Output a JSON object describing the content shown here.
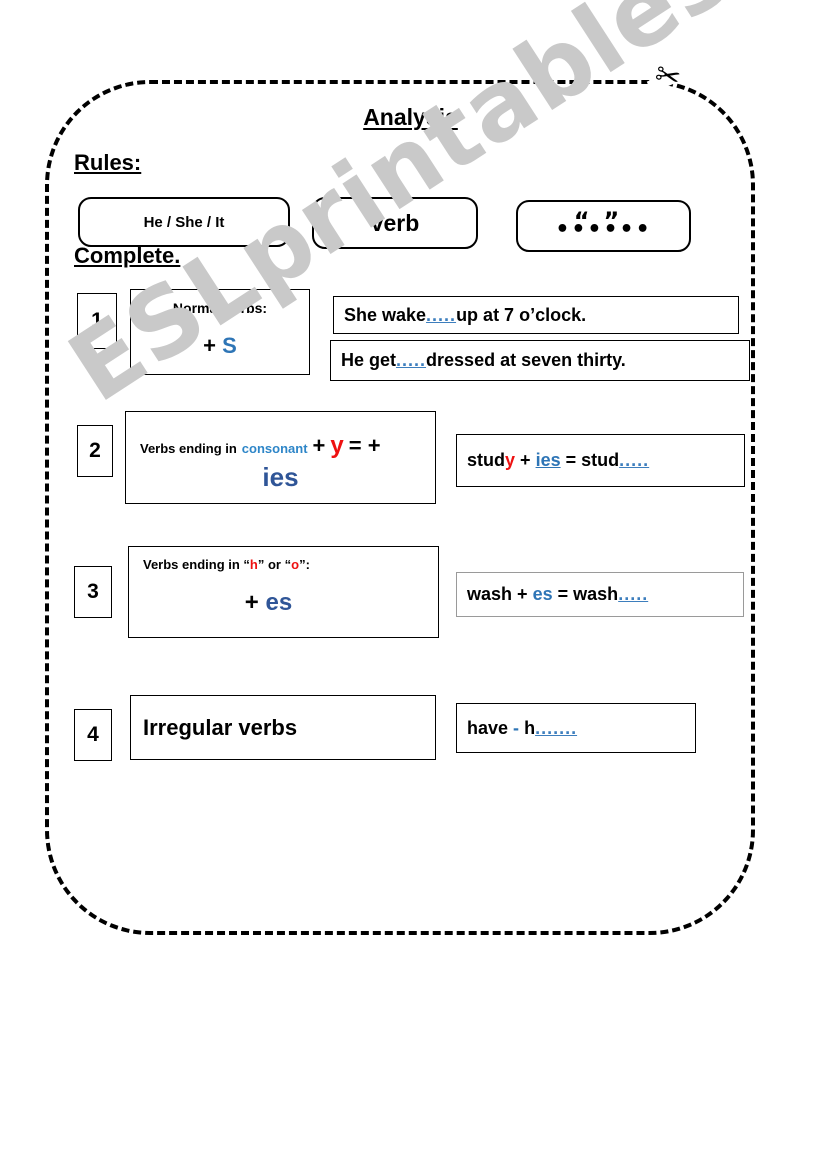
{
  "worksheet": {
    "title": "Analysis",
    "watermark": "ESLprintables.com",
    "cut_icon": "✂",
    "rules_heading": "Rules:",
    "complete_heading": "Complete.",
    "formula_chips": [
      {
        "name": "subject",
        "label": "He / She / It"
      },
      {
        "name": "verb",
        "label": "verb"
      },
      {
        "name": "ending",
        "quotes_open": "“",
        "quotes_close": "”",
        "dots": "••••••"
      }
    ],
    "rows": [
      {
        "number": "1",
        "rule": {
          "line1": "Normal verbs:",
          "big_plus": "+",
          "big_suffix": "S"
        },
        "exercises": [
          {
            "pre": "She wake",
            "blank": ".....",
            "post": " up at 7 o’clock."
          },
          {
            "pre": "He get",
            "blank": ".....",
            "post": " dressed at seven thirty."
          }
        ]
      },
      {
        "number": "2",
        "rule": {
          "line1_pre": "Verbs ending in",
          "line1_blue": "consonant",
          "line1_plus": "+",
          "line1_y": "y",
          "line1_eq": "= +",
          "line2": "ies"
        },
        "exercises": [
          {
            "word_pre": "stud",
            "word_red": "y",
            "plus": "+",
            "suffix": "ies",
            "eq": "=",
            "result": "stud",
            "blank": "....."
          }
        ]
      },
      {
        "number": "3",
        "rule": {
          "line1_pre": "Verbs ending in “",
          "line1_red1": "h",
          "line1_mid": "” or “",
          "line1_red2": "o",
          "line1_post": "”:",
          "plus": "+",
          "suffix": "es"
        },
        "exercises": [
          {
            "word": "wash",
            "plus": "+",
            "suffix": "es",
            "eq": "=",
            "result": "wash",
            "blank": "....."
          }
        ]
      },
      {
        "number": "4",
        "rule": {
          "label": "Irregular verbs"
        },
        "exercises": [
          {
            "word": "have",
            "dash": "-",
            "result": "h",
            "blank": "......."
          }
        ]
      }
    ],
    "colors": {
      "blue_light": "#2e86c8",
      "blue_dark": "#2f5597",
      "blue_mid": "#2e75b6",
      "red": "#ee1111",
      "blank_blue": "#3d7ebd",
      "watermark_gray": "#c9c9c9",
      "frame": "#000000"
    }
  }
}
